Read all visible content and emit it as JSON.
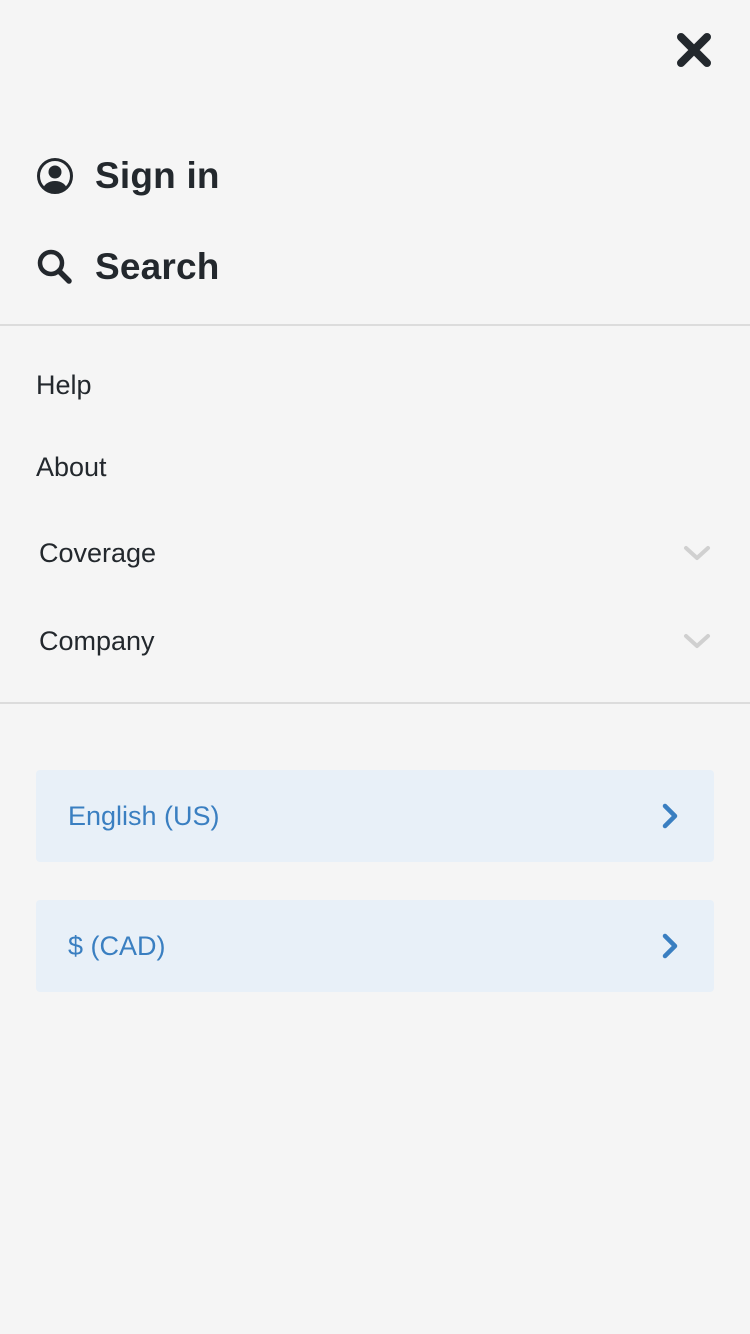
{
  "header": {
    "close_icon": "close-icon"
  },
  "primary": {
    "sign_in": {
      "label": "Sign in",
      "icon": "user-circle-icon"
    },
    "search": {
      "label": "Search",
      "icon": "search-icon"
    }
  },
  "secondary": {
    "help": "Help",
    "about": "About",
    "coverage": {
      "label": "Coverage",
      "icon": "chevron-down-icon"
    },
    "company": {
      "label": "Company",
      "icon": "chevron-down-icon"
    }
  },
  "preferences": {
    "language": {
      "label": "English (US)",
      "icon": "chevron-right-icon"
    },
    "currency": {
      "label": "$ (CAD)",
      "icon": "chevron-right-icon"
    }
  },
  "colors": {
    "background": "#f5f5f5",
    "text": "#23282d",
    "accent": "#3a7fc1",
    "pref_background": "#e8f0f8",
    "divider": "#dcdcdc",
    "chevron_muted": "#d0d0d0"
  }
}
